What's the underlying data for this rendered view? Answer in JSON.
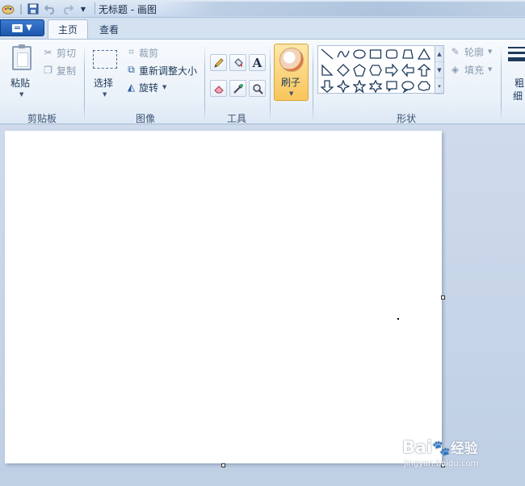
{
  "window": {
    "title": "无标题 - 画图"
  },
  "tabs": {
    "home": "主页",
    "view": "查看"
  },
  "clipboard": {
    "paste": "粘贴",
    "cut": "剪切",
    "copy": "复制",
    "group_label": "剪贴板"
  },
  "image": {
    "select": "选择",
    "crop": "裁剪",
    "resize": "重新调整大小",
    "rotate": "旋转",
    "group_label": "图像"
  },
  "tools": {
    "group_label": "工具",
    "pencil_icon": "pencil-icon",
    "fill_icon": "fill-bucket-icon",
    "text_glyph": "A",
    "eraser_icon": "eraser-icon",
    "picker_icon": "color-picker-icon",
    "magnifier_icon": "magnifier-icon"
  },
  "brushes": {
    "label": "刷子"
  },
  "shapes": {
    "outline": "轮廓",
    "fill": "填充",
    "group_label": "形状"
  },
  "size": {
    "label_1": "粗",
    "label_2": "细"
  },
  "watermark": {
    "main": "Bai",
    "brand": "经验",
    "url": "jingyan.baidu.com"
  },
  "colors": {
    "accent_blue": "#1c57ac",
    "brush_selected": "#f8c55a",
    "ribbon_text": "#1e395b"
  }
}
